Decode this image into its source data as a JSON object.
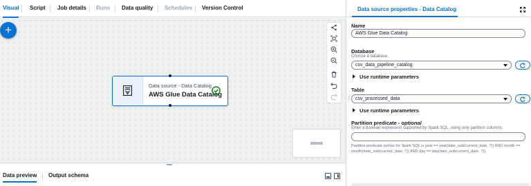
{
  "tabs": [
    {
      "label": "Visual",
      "state": "active"
    },
    {
      "label": "Script",
      "state": "normal"
    },
    {
      "label": "Job details",
      "state": "normal"
    },
    {
      "label": "Runs",
      "state": "disabled"
    },
    {
      "label": "Data quality",
      "state": "normal"
    },
    {
      "label": "Schedules",
      "state": "disabled"
    },
    {
      "label": "Version Control",
      "state": "normal"
    }
  ],
  "canvas": {
    "add_button_symbol": "+",
    "toolbar_icons": [
      "share-icon",
      "fit-view-icon",
      "zoom-in-icon",
      "zoom-out-icon",
      "delete-icon",
      "undo-icon",
      "redo-icon"
    ],
    "node": {
      "kind": "Data source - Data Catalog",
      "name": "AWS Glue Data Catalog",
      "status": "success"
    }
  },
  "bottom": {
    "tabs": [
      "Data preview",
      "Output schema"
    ]
  },
  "panel": {
    "title": "Data source properties - Data Catalog",
    "name_label": "Name",
    "name_value": "AWS Glue Data Catalog",
    "database_label": "Database",
    "database_desc": "Choose a database.",
    "database_value": "csv_data_pipeline_catalog",
    "runtime_params_label": "Use runtime parameters",
    "table_label": "Table",
    "table_value": "csv_processed_data",
    "partition_label": "Partition predicate - ",
    "partition_optional": "optional",
    "partition_desc": "Enter a boolean expression supported by Spark SQL, using only partition columns.",
    "partition_value": "",
    "partition_hint": "Partition predicate syntax for Spark SQL is year == year(date_sub(current_date, 7)) AND month == month(date_sub(current_date, 7)) AND day == day(date_sub(current_date, 7))."
  },
  "colors": {
    "accent": "#0972d3",
    "success": "#037f0c",
    "canvas_bg": "#eef0f1"
  }
}
